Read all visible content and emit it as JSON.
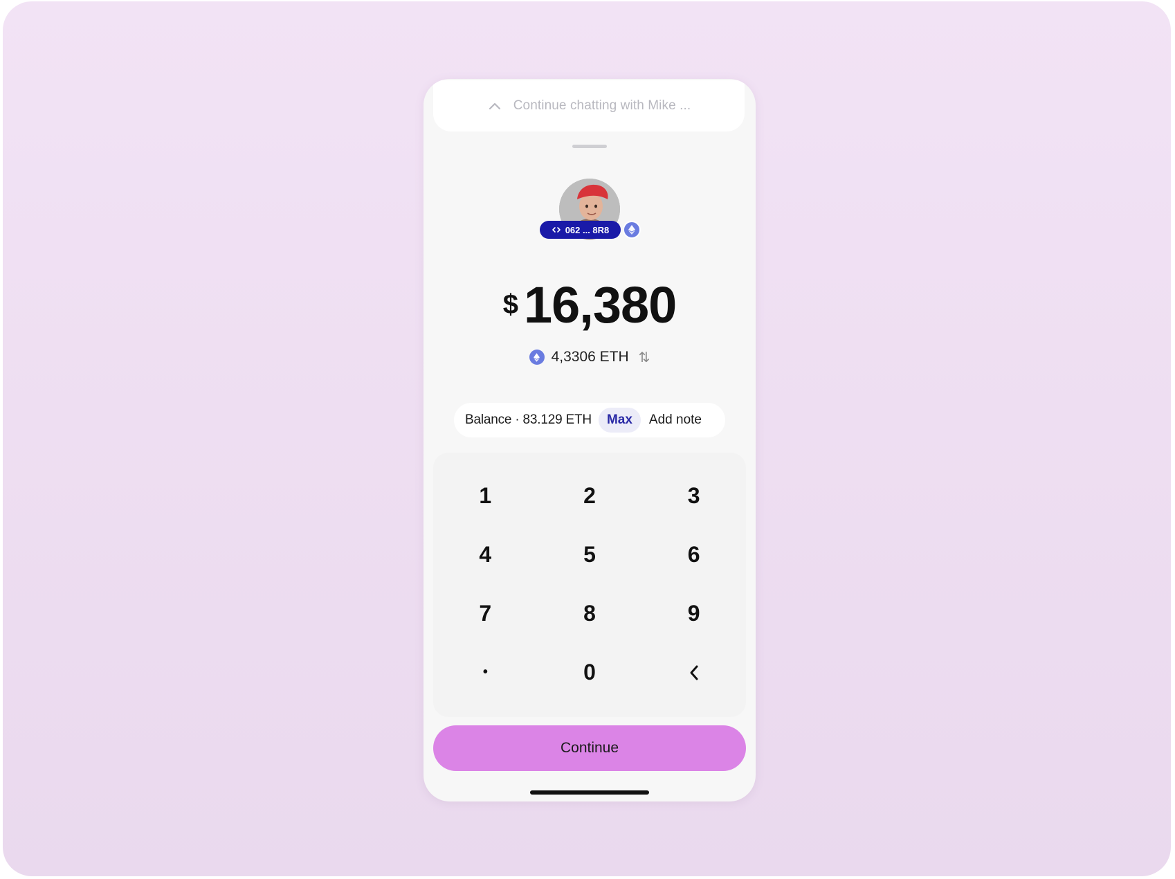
{
  "chat_bar": {
    "text": "Continue chatting with Mike ...",
    "icon": "chevron-up-icon"
  },
  "recipient": {
    "avatar_icon": "user-avatar",
    "address_label": "062 ... 8R8",
    "address_icon": "link-icon",
    "network_icon": "ethereum-icon"
  },
  "amount": {
    "currency_symbol": "$",
    "value": "16,380",
    "eth_value": "4,3306 ETH",
    "eth_icon": "ethereum-icon",
    "swap_icon": "swap-arrows-icon",
    "swap_glyph": "⇅"
  },
  "balance_row": {
    "balance_text": "Balance · 83.129 ETH",
    "max_label": "Max",
    "note_label": "Add note"
  },
  "keypad": {
    "keys": [
      "1",
      "2",
      "3",
      "4",
      "5",
      "6",
      "7",
      "8",
      "9",
      "•",
      "0"
    ],
    "backspace_icon": "chevron-left-icon"
  },
  "continue_label": "Continue",
  "colors": {
    "background": "#f0e2f4",
    "accent": "#db84e6",
    "address_pill": "#1a1aa8",
    "eth": "#6a7ce0"
  }
}
